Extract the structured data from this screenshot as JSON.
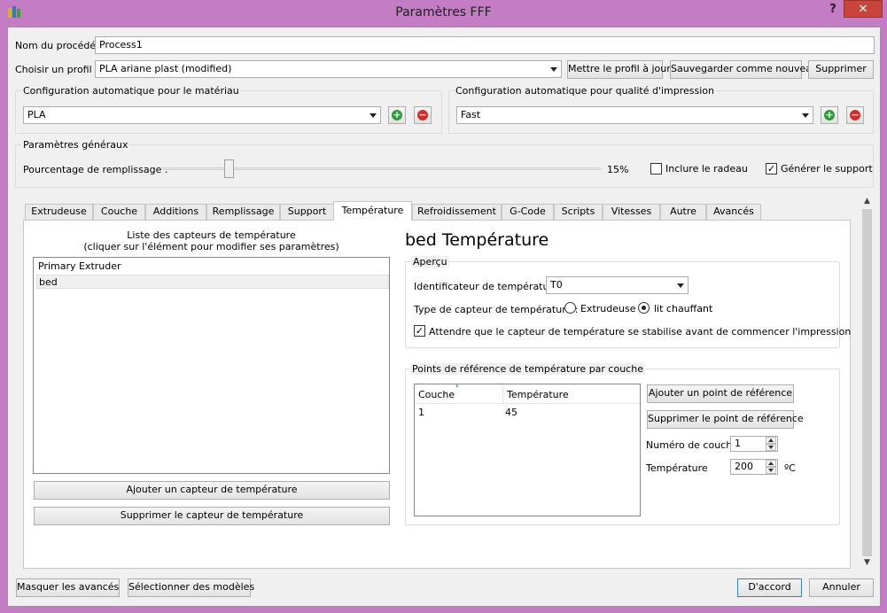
{
  "window": {
    "title": "Paramètres FFF",
    "help": "?",
    "close": "✕"
  },
  "process": {
    "name_label": "Nom du procédé :",
    "name_value": "Process1",
    "profile_label": "Choisir un profil :",
    "profile_value": "PLA ariane plast (modified)",
    "update_profile": "Mettre le profil à jour",
    "save_new": "Sauvegarder comme nouveau",
    "delete": "Supprimer"
  },
  "material_auto": {
    "title": "Configuration automatique pour le matériau",
    "value": "PLA"
  },
  "quality_auto": {
    "title": "Configuration automatique pour qualité d'impression",
    "value": "Fast"
  },
  "general": {
    "title": "Paramètres généraux",
    "infill_label": "Pourcentage de remplissage :",
    "infill_value": "15%",
    "infill_fraction": 0.15,
    "raft_label": "Inclure le radeau",
    "raft_checked": false,
    "support_label": "Générer le support",
    "support_checked": true
  },
  "tabs": [
    {
      "label": "Extrudeuse"
    },
    {
      "label": "Couche"
    },
    {
      "label": "Additions"
    },
    {
      "label": "Remplissage"
    },
    {
      "label": "Support"
    },
    {
      "label": "Température"
    },
    {
      "label": "Refroidissement"
    },
    {
      "label": "G-Code"
    },
    {
      "label": "Scripts"
    },
    {
      "label": "Vitesses"
    },
    {
      "label": "Autre"
    },
    {
      "label": "Avancés"
    }
  ],
  "sensors": {
    "list_title_1": "Liste des capteurs de température",
    "list_title_2": "(cliquer sur l'élément pour modifier ses paramètres)",
    "items": [
      "Primary Extruder",
      "bed"
    ],
    "add": "Ajouter un capteur de température",
    "remove": "Supprimer le capteur de température"
  },
  "detail": {
    "heading": "bed Température",
    "overview_title": "Aperçu",
    "identifier_label": "Identificateur de température",
    "identifier_value": "T0",
    "type_label": "Type de capteur de température :",
    "type_extruder": "Extrudeuse",
    "type_bed": "lit chauffant",
    "wait_label": "Attendre que le capteur de température se stabilise avant de commencer l'impression",
    "wait_checked": true
  },
  "setpoints": {
    "title": "Points de référence de température par couche",
    "col_layer": "Couche",
    "col_temp": "Température",
    "rows": [
      {
        "layer": "1",
        "temp": "45"
      }
    ],
    "add": "Ajouter un point de référence",
    "remove": "Supprimer le point de référence",
    "layer_label": "Numéro de couche",
    "layer_value": "1",
    "temp_label": "Température",
    "temp_value": "200",
    "temp_unit": "ºC"
  },
  "footer": {
    "hide_advanced": "Masquer les avancés",
    "select_models": "Sélectionner des modèles",
    "ok": "D'accord",
    "cancel": "Annuler"
  },
  "colors": {
    "frame": "#c47cc4",
    "close": "#c7453a",
    "plus": "#2e9b3a",
    "minus": "#d22d2d"
  }
}
